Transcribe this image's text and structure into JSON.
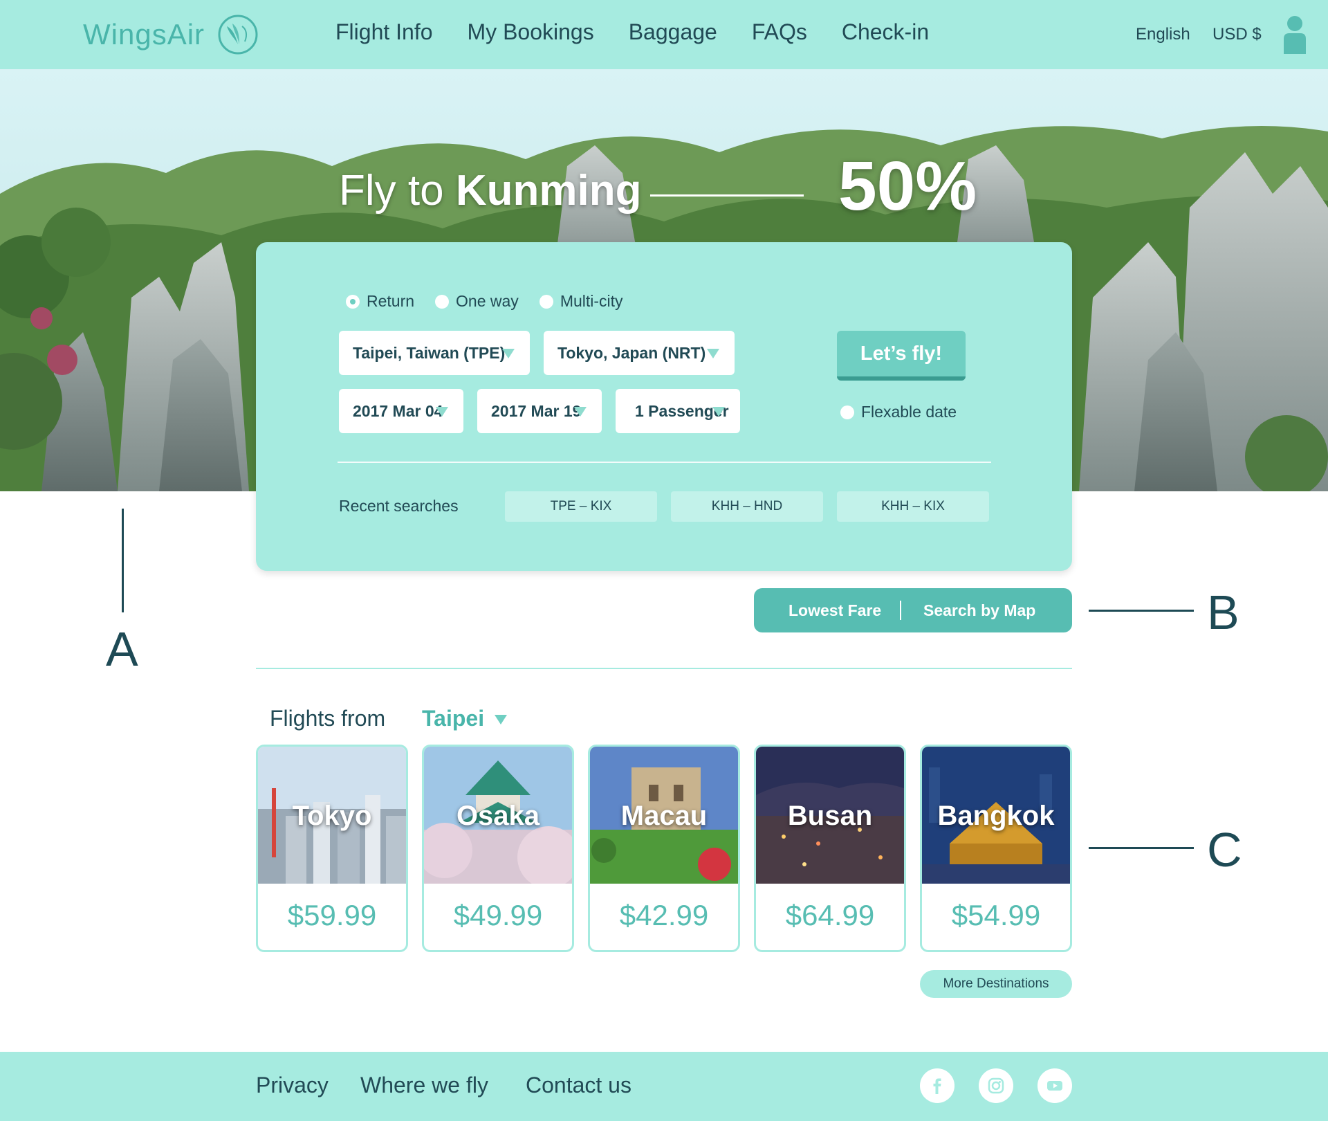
{
  "brand": {
    "name": "WingsAir"
  },
  "nav": {
    "items": [
      "Flight Info",
      "My Bookings",
      "Baggage",
      "FAQs",
      "Check-in"
    ]
  },
  "header": {
    "language": "English",
    "currency": "USD $"
  },
  "hero": {
    "title_prefix": "Fly to",
    "title_city": "Kunming",
    "discount": "50%"
  },
  "search": {
    "trip_types": [
      "Return",
      "One way",
      "Multi-city"
    ],
    "selected_trip_type": "Return",
    "origin": "Taipei, Taiwan (TPE)",
    "destination": "Tokyo, Japan (NRT)",
    "depart_date": "2017 Mar 04",
    "return_date": "2017 Mar 19",
    "passengers": "1 Passenger",
    "submit_label": "Let’s fly!",
    "flexible_label": "Flexable date",
    "flexible_checked": false,
    "recent_label": "Recent searches",
    "recent": [
      "TPE – KIX",
      "KHH – HND",
      "KHH – KIX"
    ]
  },
  "fare_toggle": {
    "options": [
      "Lowest Fare",
      "Search by Map"
    ]
  },
  "annotations": {
    "a": "A",
    "b": "B",
    "c": "C"
  },
  "flights_from": {
    "label": "Flights from",
    "city": "Taipei",
    "destinations": [
      {
        "city": "Tokyo",
        "price": "$59.99"
      },
      {
        "city": "Osaka",
        "price": "$49.99"
      },
      {
        "city": "Macau",
        "price": "$42.99"
      },
      {
        "city": "Busan",
        "price": "$64.99"
      },
      {
        "city": "Bangkok",
        "price": "$54.99"
      }
    ],
    "more_label": "More Destinations"
  },
  "footer": {
    "links": [
      "Privacy",
      "Where we fly",
      "Contact us"
    ],
    "social": [
      "facebook-icon",
      "instagram-icon",
      "youtube-icon"
    ]
  },
  "colors": {
    "mint": "#a6ebe0",
    "teal": "#57bdb2",
    "dark_teal": "#1e4a55",
    "button": "#6fcfc2"
  }
}
